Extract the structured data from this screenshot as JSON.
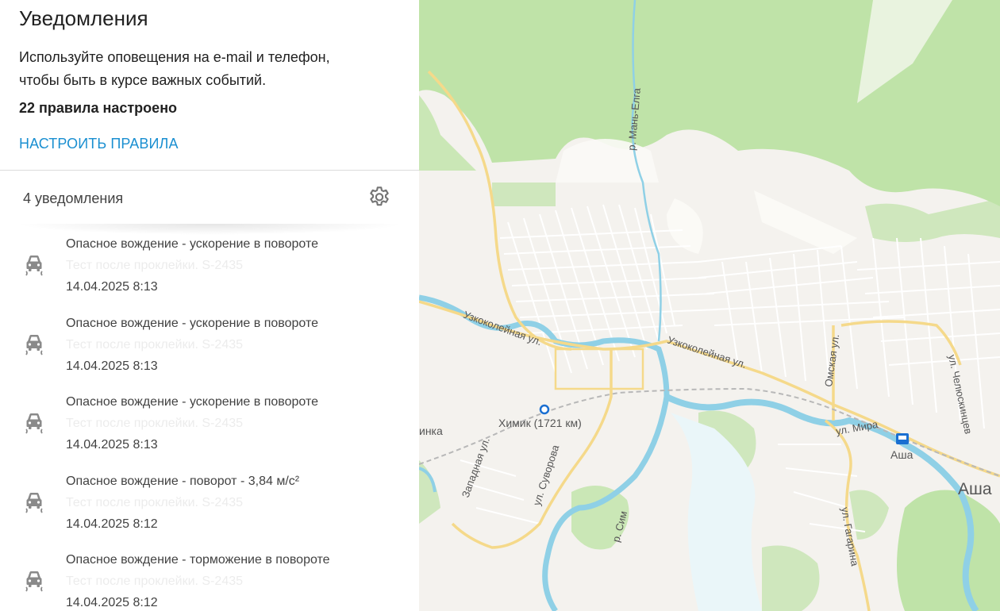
{
  "panel": {
    "title": "Уведомления",
    "description": "Используйте оповещения на e-mail и телефон, чтобы быть в курсе важных событий.",
    "rules_count": "22 правила настроено",
    "configure_link": "НАСТРОИТЬ ПРАВИЛА",
    "notifications_count": "4 уведомления",
    "settings_icon": "gear-icon"
  },
  "notifications": [
    {
      "title": "Опасное вождение - ускорение в повороте",
      "subtitle": "Тест после проклейки. S-2435",
      "time": "14.04.2025 8:13",
      "icon": "skidding-car-icon"
    },
    {
      "title": "Опасное вождение - ускорение в повороте",
      "subtitle": "Тест после проклейки. S-2435",
      "time": "14.04.2025 8:13",
      "icon": "skidding-car-icon"
    },
    {
      "title": "Опасное вождение - ускорение в повороте",
      "subtitle": "Тест после проклейки. S-2435",
      "time": "14.04.2025 8:13",
      "icon": "skidding-car-icon"
    },
    {
      "title": "Опасное вождение - поворот - 3,84 м/с²",
      "subtitle": "Тест после проклейки. S-2435",
      "time": "14.04.2025 8:12",
      "icon": "skidding-car-icon"
    },
    {
      "title": "Опасное вождение - торможение в повороте",
      "subtitle": "Тест после проклейки. S-2435",
      "time": "14.04.2025 8:12",
      "icon": "skidding-car-icon"
    }
  ],
  "map": {
    "labels": {
      "river_man_elga": "р. Мань-Елга",
      "street_uzkokoleynaya_1": "Узкоколейная ул.",
      "street_uzkokoleynaya_2": "Узкоколейная ул.",
      "street_omskaya": "Омская ул.",
      "street_chelyuskintsev": "ул. Челюскинцев",
      "station_khimik": "Химик (1721 км)",
      "street_mira": "ул. Мира",
      "station_asha": "Аша",
      "city_asha": "Аша",
      "place_partial": "инка",
      "street_zapadnaya": "Западная ул.",
      "street_suvorova": "ул. Суворова",
      "river_sim": "р. Сим",
      "street_gagarina": "ул. Гагарина"
    },
    "colors": {
      "forest": "#bfe3a8",
      "water": "#8fd0e6",
      "main_road": "#f5d98a",
      "background": "#f4f2ee"
    }
  }
}
